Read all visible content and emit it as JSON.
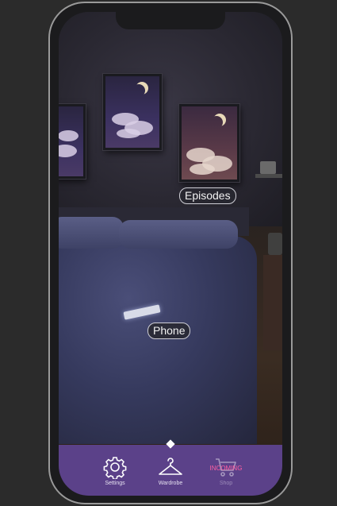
{
  "hotspots": {
    "episodes": "Episodes",
    "phone": "Phone"
  },
  "nav": {
    "settings_label": "Settings",
    "wardrobe_label": "Wardrobe",
    "shop_label": "Shop",
    "shop_badge": "INCOMING"
  },
  "colors": {
    "nav_background": "#5b4189",
    "badge": "#ff5fa2",
    "app_background": "#2b2b2b"
  },
  "icons": [
    "gear-icon",
    "hanger-icon",
    "cart-icon"
  ]
}
